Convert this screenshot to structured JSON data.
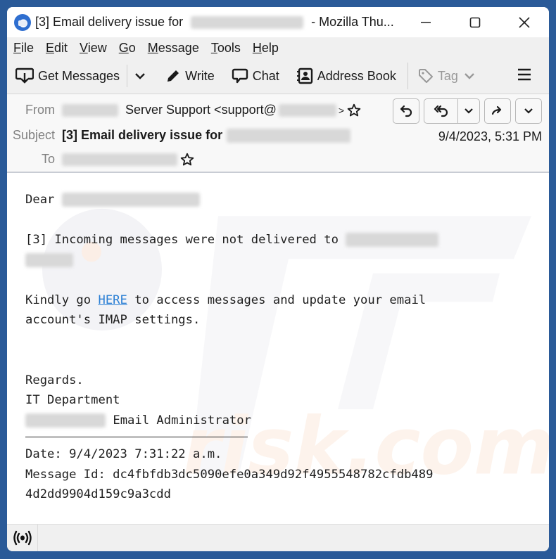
{
  "window": {
    "title_prefix": "[3] Email delivery issue for",
    "title_suffix": "- Mozilla Thu...",
    "controls": {
      "minimize": "—",
      "maximize": "☐",
      "close": "✕"
    }
  },
  "menubar": {
    "items": [
      {
        "u": "F",
        "rest": "ile"
      },
      {
        "u": "E",
        "rest": "dit"
      },
      {
        "u": "V",
        "rest": "iew"
      },
      {
        "u": "G",
        "rest": "o"
      },
      {
        "u": "M",
        "rest": "essage"
      },
      {
        "u": "T",
        "rest": "ools"
      },
      {
        "u": "H",
        "rest": "elp"
      }
    ]
  },
  "toolbar": {
    "get_messages": "Get Messages",
    "write": "Write",
    "chat": "Chat",
    "address_book": "Address Book",
    "tag": "Tag"
  },
  "header": {
    "from_label": "From",
    "from_name": "Server Support <support@",
    "from_close": ">",
    "subject_label": "Subject",
    "subject": "[3] Email delivery issue for",
    "to_label": "To",
    "date": "9/4/2023, 5:31 PM"
  },
  "message": {
    "greeting": "Dear",
    "line1": "[3] Incoming messages were not delivered to",
    "kindly_pre": "Kindly go ",
    "link_text": "HERE",
    "kindly_post": " to access messages and update your email",
    "line_imap": "account's IMAP settings.",
    "regards": "Regards.",
    "department": "IT Department",
    "admin": " Email Administrator",
    "date_line": "Date: 9/4/2023 7:31:22 a.m.",
    "msgid_line1": "Message Id: dc4fbfdb3dc5090efe0a349d92f4955548782cfdb489",
    "msgid_line2": "4d2dd9904d159c9a3cdd"
  },
  "colors": {
    "desktop": "#2a5a98",
    "link": "#2a7fd4",
    "accent": "#2f6fd0"
  }
}
